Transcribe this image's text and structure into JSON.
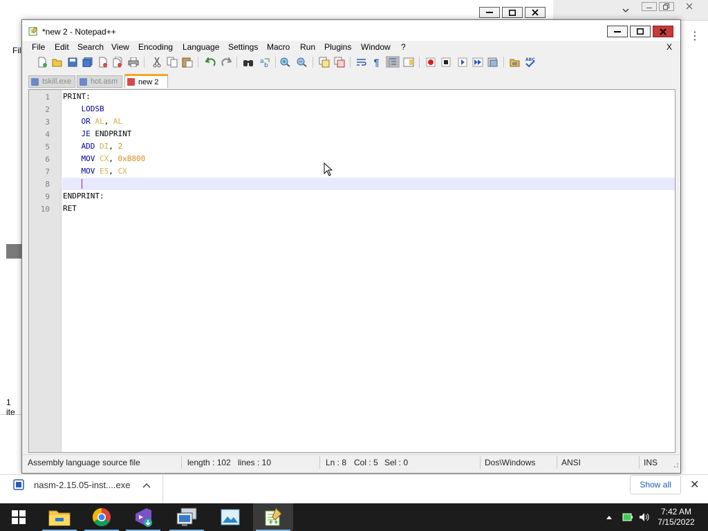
{
  "window": {
    "title": "*new  2 - Notepad++"
  },
  "menu": {
    "items": [
      "File",
      "Edit",
      "Search",
      "View",
      "Encoding",
      "Language",
      "Settings",
      "Macro",
      "Run",
      "Plugins",
      "Window",
      "?"
    ],
    "close_label": "X"
  },
  "toolbar": {
    "buttons": [
      "new-file",
      "open-file",
      "save",
      "save-all",
      "close",
      "close-all",
      "print",
      "cut",
      "copy",
      "paste",
      "undo",
      "redo",
      "find",
      "replace",
      "zoom-in",
      "zoom-out",
      "sync-vertical",
      "sync-horizontal",
      "word-wrap",
      "show-all-characters",
      "indent-guide",
      "document-map",
      "record-macro",
      "stop-recording",
      "playback-macro",
      "run-macro-multiple",
      "save-macro",
      "open-folder",
      "spell-check"
    ]
  },
  "tabs": [
    {
      "label": "tskill.exe",
      "active": false
    },
    {
      "label": "hot.asm",
      "active": false
    },
    {
      "label": "new  2",
      "active": true
    }
  ],
  "editor": {
    "lines": [
      {
        "num": "1",
        "tokens": [
          {
            "t": "PRINT:",
            "c": "plain"
          }
        ]
      },
      {
        "num": "2",
        "tokens": [
          {
            "t": "    ",
            "c": "plain"
          },
          {
            "t": "LODSB",
            "c": "kw"
          }
        ]
      },
      {
        "num": "3",
        "tokens": [
          {
            "t": "    ",
            "c": "plain"
          },
          {
            "t": "OR",
            "c": "kw"
          },
          {
            "t": " ",
            "c": "plain"
          },
          {
            "t": "AL",
            "c": "reg"
          },
          {
            "t": ", ",
            "c": "plain"
          },
          {
            "t": "AL",
            "c": "reg"
          }
        ]
      },
      {
        "num": "4",
        "tokens": [
          {
            "t": "    ",
            "c": "plain"
          },
          {
            "t": "JE",
            "c": "kw"
          },
          {
            "t": " ENDPRINT",
            "c": "plain"
          }
        ]
      },
      {
        "num": "5",
        "tokens": [
          {
            "t": "    ",
            "c": "plain"
          },
          {
            "t": "ADD",
            "c": "kw"
          },
          {
            "t": " ",
            "c": "plain"
          },
          {
            "t": "DI",
            "c": "reg"
          },
          {
            "t": ", ",
            "c": "plain"
          },
          {
            "t": "2",
            "c": "num"
          }
        ]
      },
      {
        "num": "6",
        "tokens": [
          {
            "t": "    ",
            "c": "plain"
          },
          {
            "t": "MOV",
            "c": "kw"
          },
          {
            "t": " ",
            "c": "plain"
          },
          {
            "t": "CX",
            "c": "reg"
          },
          {
            "t": ", ",
            "c": "plain"
          },
          {
            "t": "0xB800",
            "c": "num"
          }
        ]
      },
      {
        "num": "7",
        "tokens": [
          {
            "t": "    ",
            "c": "plain"
          },
          {
            "t": "MOV",
            "c": "kw"
          },
          {
            "t": " ",
            "c": "plain"
          },
          {
            "t": "ES",
            "c": "reg"
          },
          {
            "t": ", ",
            "c": "plain"
          },
          {
            "t": "CX",
            "c": "reg"
          }
        ]
      },
      {
        "num": "8",
        "tokens": [
          {
            "t": "    ",
            "c": "plain"
          }
        ],
        "current": true
      },
      {
        "num": "9",
        "tokens": [
          {
            "t": "ENDPRINT:",
            "c": "plain"
          }
        ]
      },
      {
        "num": "10",
        "tokens": [
          {
            "t": "RET",
            "c": "plain"
          }
        ]
      }
    ]
  },
  "status": {
    "filetype": "Assembly language source file",
    "length": "length : 102",
    "lines": "lines : 10",
    "ln": "Ln : 8",
    "col": "Col : 5",
    "sel": "Sel : 0",
    "eol": "Dos\\Windows",
    "encoding": "ANSI",
    "mode": "INS"
  },
  "background": {
    "explorer_menu_label": "Fil",
    "explorer_status": "1 ite"
  },
  "downloads": {
    "filename": "nasm-2.15.05-inst....exe",
    "show_all": "Show all"
  },
  "taskbar": {
    "apps": [
      "start",
      "file-explorer",
      "chrome",
      "visual-studio-installer",
      "remote-desktop",
      "photos",
      "notepad-plus-plus"
    ],
    "time": "7:42 AM",
    "date": "7/15/2022"
  },
  "colors": {
    "keyword": "#0000a0",
    "register": "#cfae6a",
    "number": "#e08a1e",
    "current_line": "#e8e8ff",
    "active_tab_accent": "#f5a623"
  }
}
